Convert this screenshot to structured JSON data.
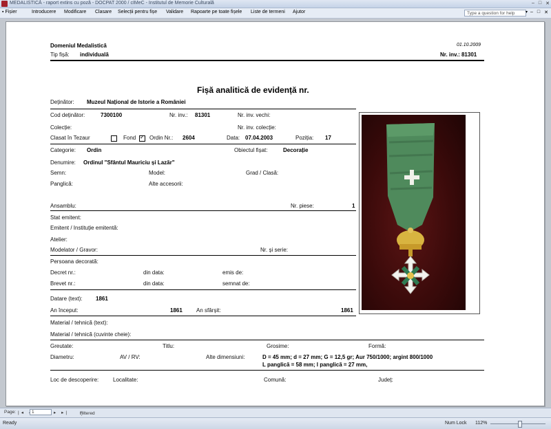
{
  "app": {
    "title": "MEDALISTICĂ - raport extins cu poză - DOCPAT 2000 / cIMeC - Institutul de Memorie Culturală",
    "window_controls": [
      "–",
      "□",
      "✕"
    ]
  },
  "menu": [
    {
      "label": "Fișier"
    },
    {
      "label": "Introducere"
    },
    {
      "label": "Modificare"
    },
    {
      "label": "Clasare"
    },
    {
      "label": "Selecții pentru fișe"
    },
    {
      "label": "Validare"
    },
    {
      "label": "Rapoarte pe toate fișele"
    },
    {
      "label": "Liste de termeni"
    },
    {
      "label": "Ajutor"
    }
  ],
  "help": {
    "placeholder": "Type a question for help",
    "mdi": [
      "–",
      "□",
      "✕"
    ]
  },
  "report": {
    "domain": "Domeniul Medalistică",
    "date": "01.10.2009",
    "tip_label": "Tip fișă:",
    "tip_value": "individuală",
    "nrinv_label": "Nr. inv.:",
    "nrinv_value": "81301",
    "heading": "Fișă analitică de evidență nr.",
    "detinator_label": "Deținător:",
    "detinator_value": "Muzeul Național de Istorie a României",
    "cod_label": "Cod deținător:",
    "cod_value": "7300100",
    "nrinv2_label": "Nr. inv.:",
    "nrinv2_value": "81301",
    "nrinvvechi_label": "Nr. inv. vechi:",
    "colectie_label": "Colecție:",
    "nrinvcol_label": "Nr. inv. colecție:",
    "clasat_label": "Clasat în Tezaur",
    "fond_label": "Fond",
    "ordin_label": "Ordin Nr.:",
    "ordin_value": "2604",
    "data_label": "Data:",
    "data_value": "07.04.2003",
    "pozitia_label": "Poziția:",
    "pozitia_value": "17",
    "categorie_label": "Categorie:",
    "categorie_value": "Ordin",
    "obiect_label": "Obiectul fișat:",
    "obiect_value": "Decorație",
    "denumire_label": "Denumire:",
    "denumire_value": "Ordinul \"Sfântul Mauriciu și Lazăr\"",
    "semn_label": "Semn:",
    "model_label": "Model:",
    "grad_label": "Grad / Clasă:",
    "panglica_label": "Panglică:",
    "alte_acc_label": "Alte accesorii:",
    "ansamblu_label": "Ansamblu:",
    "nrpiese_label": "Nr. piese:",
    "nrpiese_value": "1",
    "stat_label": "Stat emitent:",
    "emitent_label": "Emitent / Instituție emitentă:",
    "atelier_label": "Atelier:",
    "modelator_label": "Modelator / Gravor:",
    "nrserie_label": "Nr. și serie:",
    "persoana_label": "Persoana decorată:",
    "decret_label": "Decret nr.:",
    "dindata1_label": "din data:",
    "emis_label": "emis de:",
    "brevet_label": "Brevet nr.:",
    "dindata2_label": "din data:",
    "semnat_label": "semnat de:",
    "datare_label": "Datare (text):",
    "datare_value": "1861",
    "aninceput_label": "An început:",
    "aninceput_value": "1861",
    "ansfarsit_label": "An sfârșit:",
    "ansfarsit_value": "1861",
    "material_label": "Material / tehnică (text):",
    "material2_label": "Material / tehnică (cuvinte cheie):",
    "greutate_label": "Greutate:",
    "titlu_label": "Titlu:",
    "grosime_label": "Grosime:",
    "forma_label": "Formă:",
    "diametru_label": "Diametru:",
    "avrv_label": "AV / RV:",
    "altedim_label": "Alte dimensiuni:",
    "altedim_value1": "D = 45 mm; d = 27 mm; G = 12,5 gr; Aur 750/1000; argint 800/1000",
    "altedim_value2": "L panglică = 58 mm; l panglică = 27 mm,",
    "loc_label": "Loc de descoperire:",
    "localitate_label": "Localitate:",
    "comuna_label": "Comună:",
    "judet_label": "Județ:"
  },
  "checkboxes": {
    "clasat": false,
    "fond": true,
    "ordin": false
  },
  "recordnav": {
    "page_label": "Page:",
    "page_value": "1",
    "nav_first_prev": "|◂ ◂",
    "nav_next_last": "▸ ▸|",
    "filtered_label": "Filtered"
  },
  "status": {
    "ready": "Ready",
    "numlock": "Num Lock",
    "zoom": "112%"
  }
}
